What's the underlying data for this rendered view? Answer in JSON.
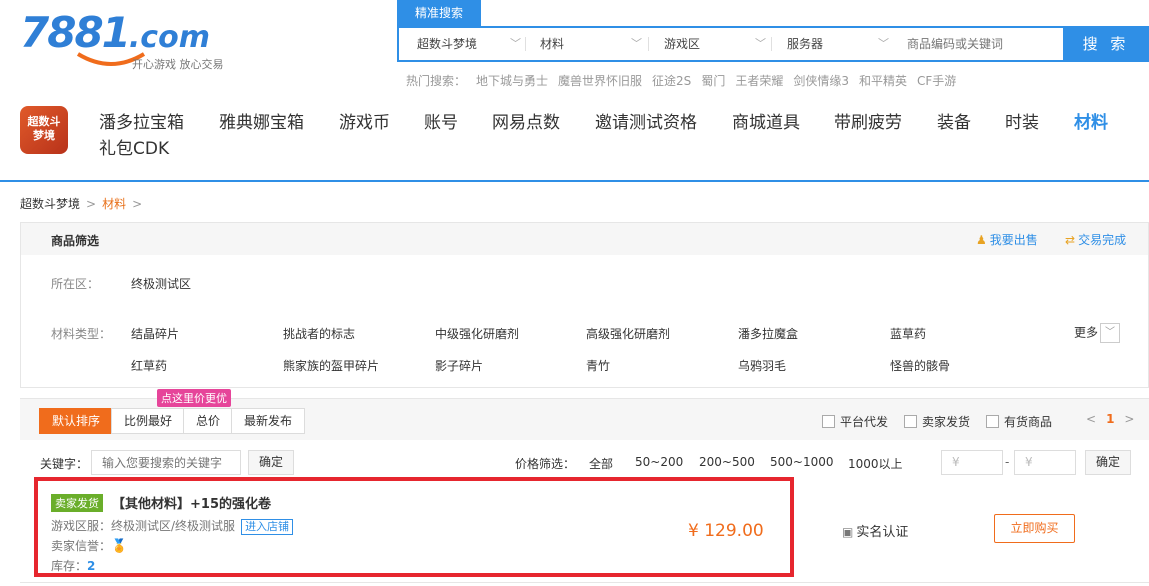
{
  "logo": {
    "main": "7881",
    "suffix": ".com",
    "slogan": "开心游戏 放心交易"
  },
  "search": {
    "tab_label": "精准搜索",
    "selects": [
      "超数斗梦境",
      "材料",
      "游戏区",
      "服务器"
    ],
    "placeholder": "商品编码或关键词",
    "button_label": "搜 索"
  },
  "hot": {
    "label": "热门搜索：",
    "items": [
      "地下城与勇士",
      "魔兽世界怀旧服",
      "征途2S",
      "蜀门",
      "王者荣耀",
      "剑侠情缘3",
      "和平精英",
      "CF手游"
    ]
  },
  "game_badge": {
    "line1": "超数斗",
    "line2": "梦境"
  },
  "nav": {
    "items": [
      "潘多拉宝箱",
      "雅典娜宝箱",
      "游戏币",
      "账号",
      "网易点数",
      "邀请测试资格",
      "商城道具",
      "带刷疲劳",
      "装备",
      "时装",
      "材料",
      "礼包CDK"
    ],
    "active": "材料"
  },
  "breadcrumb": {
    "root": "超数斗梦境",
    "current": "材料",
    "sep": ">"
  },
  "filter": {
    "title": "商品筛选",
    "sell_link": "我要出售",
    "done_link": "交易完成",
    "region_label": "所在区：",
    "region_value": "终极测试区",
    "type_label": "材料类型：",
    "types": [
      "结晶碎片",
      "挑战者的标志",
      "中级强化研磨剂",
      "高级强化研磨剂",
      "潘多拉魔盒",
      "蓝草药",
      "红草药",
      "熊家族的盔甲碎片",
      "影子碎片",
      "青竹",
      "乌鸦羽毛",
      "怪兽的骸骨"
    ],
    "more_label": "更多"
  },
  "sort": {
    "buttons": [
      "默认排序",
      "比例最好",
      "总价",
      "最新发布"
    ],
    "bubble": "点这里价更优",
    "checks": [
      "平台代发",
      "卖家发货",
      "有货商品"
    ],
    "page": "1",
    "prev": "<",
    "next": ">"
  },
  "keyword": {
    "label": "关键字：",
    "placeholder": "输入您要搜索的关键字",
    "confirm": "确定"
  },
  "price_filter": {
    "label": "价格筛选：",
    "options": [
      "全部",
      "50~200",
      "200~500",
      "500~1000",
      "1000以上"
    ],
    "min_placeholder": "¥",
    "max_placeholder": "¥",
    "dash": "-",
    "confirm": "确定"
  },
  "listing": {
    "tag": "卖家发货",
    "title": "【其他材料】+15的强化卷",
    "server_label": "游戏区服：",
    "server_value": "终极测试区/终极测试服",
    "enter_shop": "进入店铺",
    "credit_label": "卖家信誉：",
    "stock_label": "库存：",
    "stock_value": "2",
    "price": "¥ 129.00",
    "verify": "实名认证",
    "buy": "立即购买"
  },
  "colors": {
    "accent": "#2f8fe6",
    "orange": "#f06c1c",
    "highlight_border": "#e6262e"
  }
}
